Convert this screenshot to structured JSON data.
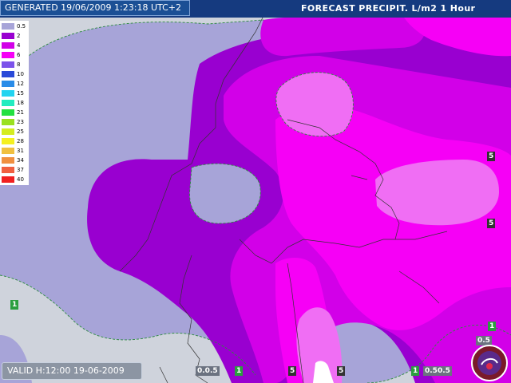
{
  "header": {
    "generated": "GENERATED 19/06/2009 1:23:18 UTC+2",
    "title": "FORECAST  PRECIPIT. L/m2  1 Hour"
  },
  "legend": [
    {
      "value": "0.5",
      "color": "#a7a4d8"
    },
    {
      "value": "2",
      "color": "#9900d0"
    },
    {
      "value": "4",
      "color": "#d200e8"
    },
    {
      "value": "6",
      "color": "#f600f6"
    },
    {
      "value": "8",
      "color": "#7c52ea"
    },
    {
      "value": "10",
      "color": "#2a4ad8"
    },
    {
      "value": "12",
      "color": "#2a8ce8"
    },
    {
      "value": "15",
      "color": "#22d4f0"
    },
    {
      "value": "18",
      "color": "#22ecc0"
    },
    {
      "value": "21",
      "color": "#22e040"
    },
    {
      "value": "23",
      "color": "#9ae020"
    },
    {
      "value": "25",
      "color": "#d4ec20"
    },
    {
      "value": "28",
      "color": "#f4f020"
    },
    {
      "value": "31",
      "color": "#f0c040"
    },
    {
      "value": "34",
      "color": "#f09040"
    },
    {
      "value": "37",
      "color": "#f06040"
    },
    {
      "value": "40",
      "color": "#f02020"
    }
  ],
  "footer": {
    "valid": "VALID H:12:00  19-06-2009"
  },
  "isolines": [
    {
      "label": "5",
      "style": "dark"
    },
    {
      "label": "5",
      "style": "dark"
    },
    {
      "label": "1",
      "style": "green"
    },
    {
      "label": "1",
      "style": "green"
    },
    {
      "label": "0.5",
      "style": "grey"
    },
    {
      "label": "0.0.5",
      "style": "grey"
    },
    {
      "label": "1",
      "style": "green"
    },
    {
      "label": "5",
      "style": "dark"
    },
    {
      "label": "5",
      "style": "dark"
    },
    {
      "label": "1",
      "style": "green"
    },
    {
      "label": "0.50.5",
      "style": "grey"
    }
  ],
  "colors": {
    "background": "#cfd3dc",
    "level_0_5": "#a7a4d8",
    "level_2": "#9900d0",
    "level_4": "#d200e8",
    "level_6": "#f600f6",
    "header": "#153a7f"
  }
}
